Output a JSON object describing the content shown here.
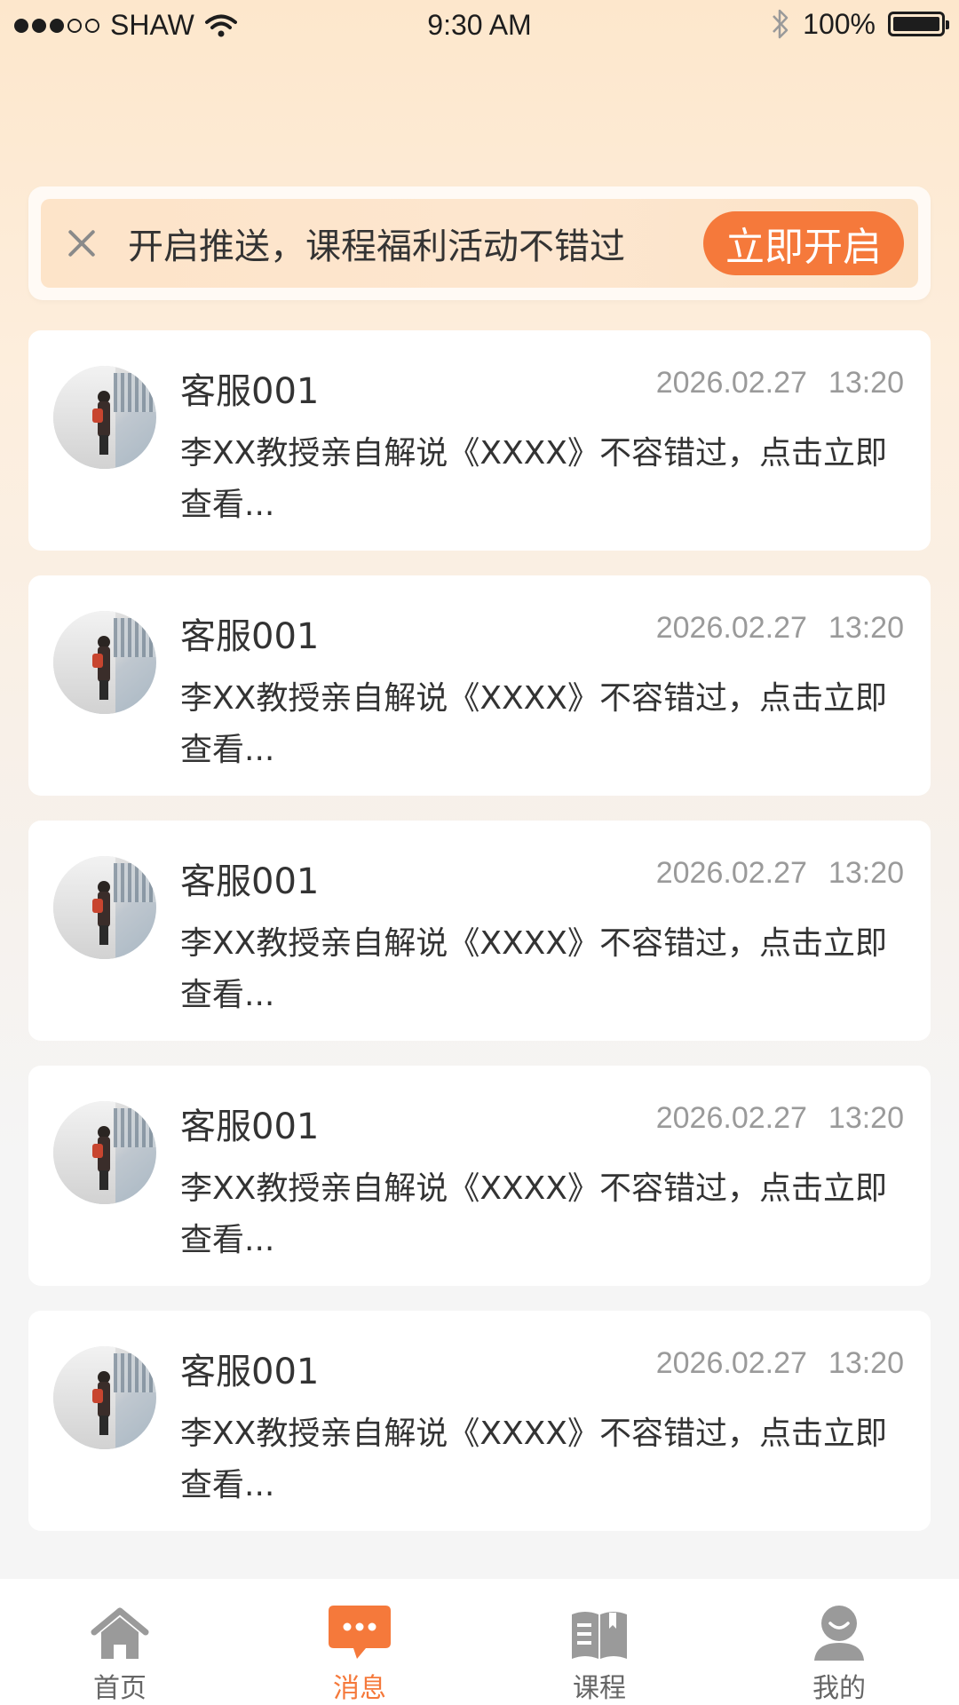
{
  "status_bar": {
    "carrier": "SHAW",
    "time": "9:30 AM",
    "battery": "100%",
    "signal_bars_filled": 3,
    "signal_bars_total": 5
  },
  "push_banner": {
    "text": "开启推送，课程福利活动不错过",
    "button_label": "立即开启",
    "icon": "close-icon"
  },
  "messages": [
    {
      "sender": "客服001",
      "date": "2026.02.27",
      "time": "13:20",
      "preview": "李XX教授亲自解说《XXXX》不容错过，点击立即查看..."
    },
    {
      "sender": "客服001",
      "date": "2026.02.27",
      "time": "13:20",
      "preview": "李XX教授亲自解说《XXXX》不容错过，点击立即查看..."
    },
    {
      "sender": "客服001",
      "date": "2026.02.27",
      "time": "13:20",
      "preview": "李XX教授亲自解说《XXXX》不容错过，点击立即查看..."
    },
    {
      "sender": "客服001",
      "date": "2026.02.27",
      "time": "13:20",
      "preview": "李XX教授亲自解说《XXXX》不容错过，点击立即查看..."
    },
    {
      "sender": "客服001",
      "date": "2026.02.27",
      "time": "13:20",
      "preview": "李XX教授亲自解说《XXXX》不容错过，点击立即查看..."
    }
  ],
  "tab_bar": {
    "tabs": [
      {
        "label": "首页",
        "icon": "home-icon",
        "active": false
      },
      {
        "label": "消息",
        "icon": "chat-bubble-icon",
        "active": true
      },
      {
        "label": "课程",
        "icon": "book-icon",
        "active": false
      },
      {
        "label": "我的",
        "icon": "user-icon",
        "active": false
      }
    ]
  },
  "colors": {
    "accent": "#f5793b",
    "text_primary": "#333333",
    "text_secondary": "#9a9a9a",
    "tab_inactive": "#9a9a9a"
  }
}
